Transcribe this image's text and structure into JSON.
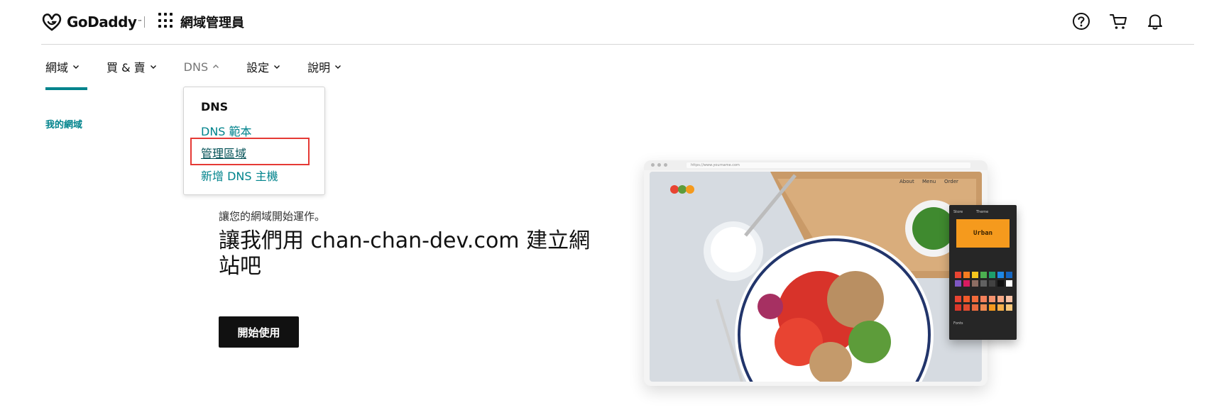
{
  "header": {
    "brand": "GoDaddy",
    "product_title": "網域管理員",
    "icons": [
      "help-icon",
      "cart-icon",
      "bell-icon"
    ]
  },
  "nav": {
    "items": [
      {
        "label": "網域"
      },
      {
        "label": "買 & 賣"
      },
      {
        "label": "DNS"
      },
      {
        "label": "設定"
      },
      {
        "label": "說明"
      }
    ]
  },
  "sidebar": {
    "link": "我的網域"
  },
  "dns_menu": {
    "heading": "DNS",
    "items": [
      {
        "label": "DNS 範本"
      },
      {
        "label": "管理區域"
      },
      {
        "label": "新增 DNS 主機"
      }
    ]
  },
  "hero": {
    "subtitle": "讓您的網域開始運作。",
    "title": "讓我們用 chan-chan-dev.com 建立網站吧",
    "button_label": "開始使用"
  },
  "mockup": {
    "url": "https://www.yourname.com",
    "nav": [
      "About",
      "Menu",
      "Order"
    ],
    "theme_tabs": [
      "Store",
      "Theme"
    ],
    "theme_name": "Urban",
    "fonts_label": "Fonts"
  },
  "colors": {
    "accent": "#00838c",
    "highlight": "#e53935",
    "button": "#111111"
  }
}
